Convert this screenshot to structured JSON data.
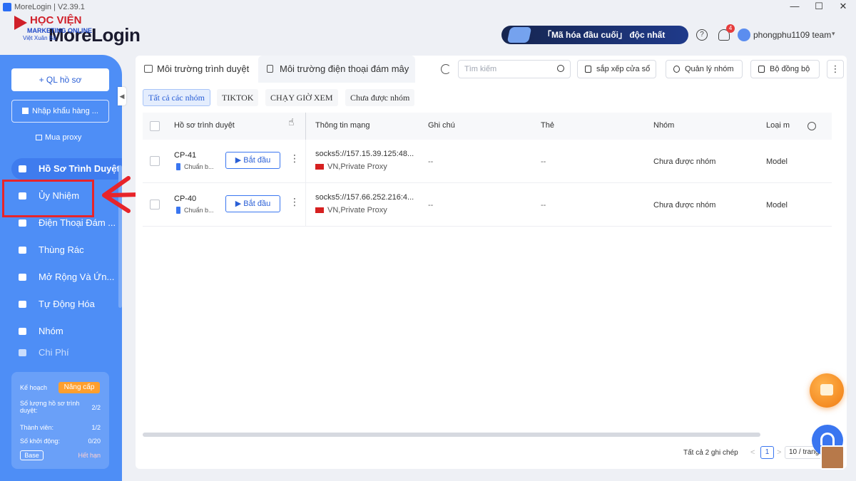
{
  "window": {
    "title": "MoreLogin | V2.39.1",
    "controls": [
      "—",
      "☐",
      "✕"
    ]
  },
  "brand": {
    "logo": "MoreLogin",
    "watermark_top": "HỌC VIỆN",
    "watermark_mid": "MARKETING ONLINE",
    "watermark_bot": "Việt Xuân Bá"
  },
  "header": {
    "promo": "「Mã hóa đầu cuối」 độc nhất",
    "help": "?",
    "notifications": "4",
    "team": "phongphu1109 team",
    "team_chevron": "▾"
  },
  "sidebar": {
    "new_profile": "+ QL hồ sơ",
    "import": "Nhập khẩu hàng ...",
    "buy_proxy": "Mua proxy",
    "items": [
      {
        "label": "Hồ Sơ Trình Duyệt",
        "active": true
      },
      {
        "label": "Ủy Nhiệm"
      },
      {
        "label": "Điện Thoại Đám ..."
      },
      {
        "label": "Thùng Rác"
      },
      {
        "label": "Mở Rộng Và Ứn..."
      },
      {
        "label": "Tự Động Hóa"
      },
      {
        "label": "Nhóm"
      },
      {
        "label": "Chi Phí"
      }
    ],
    "collapse": "◀",
    "plan": {
      "label": "Kế hoạch",
      "upgrade": "Nâng cấp",
      "profiles_label": "Số lượng hồ sơ trình duyệt:",
      "profiles_value": "2/2",
      "members_label": "Thành viên:",
      "members_value": "1/2",
      "launches_label": "Số khởi động:",
      "launches_value": "0/20",
      "tier": "Base",
      "expired": "Hết hạn"
    }
  },
  "toolbar": {
    "tab_browser": "Môi trường trình duyệt",
    "tab_cloud": "Môi trường điện thoại đám mây",
    "search_placeholder": "Tìm kiếm",
    "arrange": "sắp xếp cửa sổ",
    "groups": "Quản lý nhóm",
    "counter": "Bộ đồng bộ",
    "more": "⋮"
  },
  "filters": [
    "Tất cả các nhóm",
    "TIKTOK",
    "CHẠY GIỜ XEM",
    "Chưa được nhóm"
  ],
  "table": {
    "columns": [
      "Hồ sơ trình duyệt",
      "Thông tin mạng",
      "Ghi chú",
      "Thẻ",
      "Nhóm",
      "Loại m"
    ],
    "rows": [
      {
        "name": "CP-41",
        "status": "Chuẩn b...",
        "start": "▶ Bắt đầu",
        "more": "⋮",
        "proxy": "socks5://157.15.39.125:48...",
        "proxy_label": "VN,Private Proxy",
        "note": "--",
        "tag": "--",
        "group": "Chưa được nhóm",
        "type": "Model"
      },
      {
        "name": "CP-40",
        "status": "Chuẩn b...",
        "start": "▶ Bắt đầu",
        "more": "⋮",
        "proxy": "socks5://157.66.252.216:4...",
        "proxy_label": "VN,Private Proxy",
        "note": "--",
        "tag": "--",
        "group": "Chưa được nhóm",
        "type": "Model"
      }
    ]
  },
  "pagination": {
    "total": "Tất cả 2 ghi chép",
    "prev": "<",
    "page": "1",
    "next": ">",
    "size": "10 / trang"
  },
  "colors": {
    "sidebar": "#4e8ef6",
    "accent": "#3a76f0",
    "annotation": "#e8242a",
    "fab_gift": "#f07b12"
  }
}
